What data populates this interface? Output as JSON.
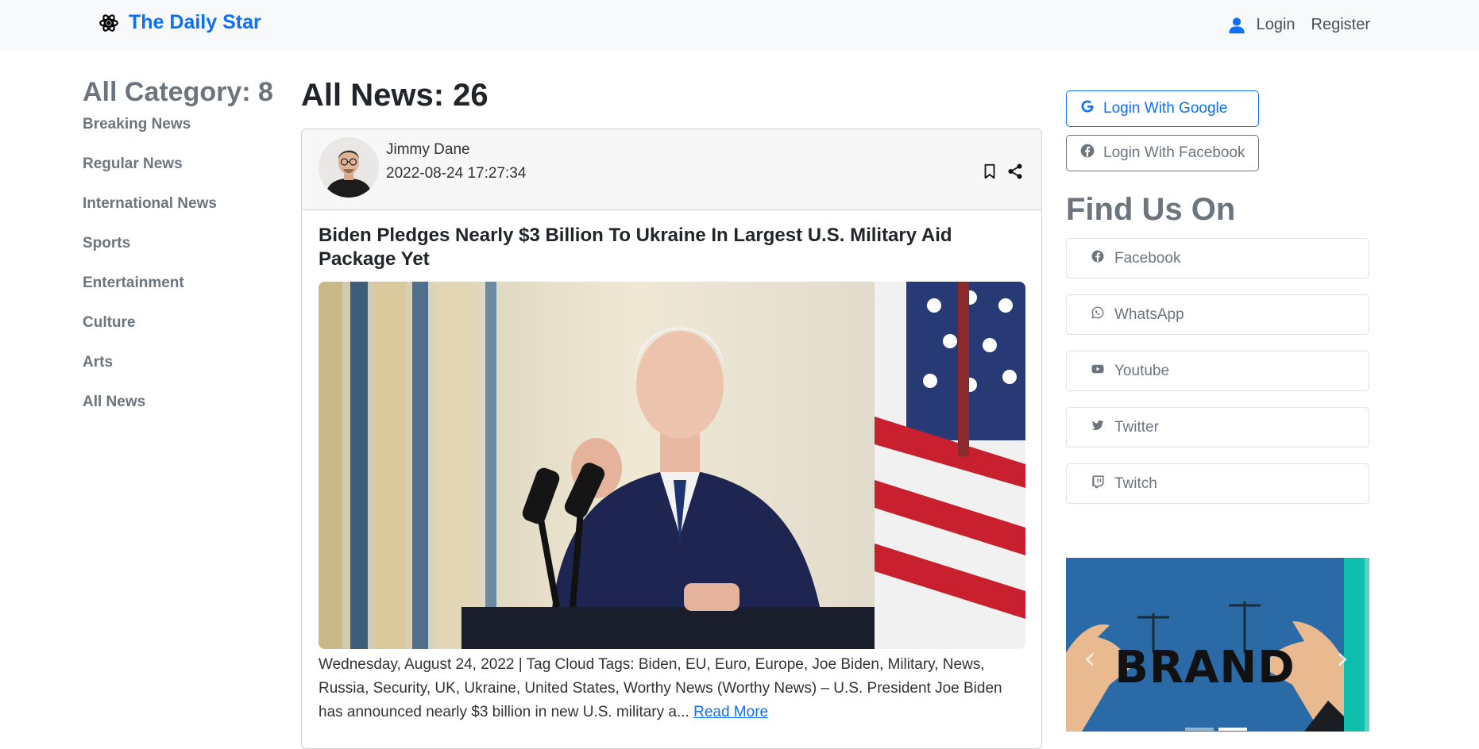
{
  "navbar": {
    "brand": "The Daily Star",
    "login_label": "Login",
    "register_label": "Register"
  },
  "categories": {
    "heading": "All Category: 8",
    "items": [
      "Breaking News",
      "Regular News",
      "International News",
      "Sports",
      "Entertainment",
      "Culture",
      "Arts",
      "All News"
    ]
  },
  "main": {
    "heading": "All News: 26",
    "article": {
      "author": "Jimmy Dane",
      "date": "2022-08-24 17:27:34",
      "title": "Biden Pledges Nearly $3 Billion To Ukraine In Largest U.S. Military Aid Package Yet",
      "excerpt": "Wednesday, August 24, 2022 | Tag Cloud Tags: Biden, EU, Euro, Europe, Joe Biden, Military, News, Russia, Security, UK, Ukraine, United States, Worthy News (Worthy News) – U.S. President Joe Biden has announced nearly $3 billion in new U.S. military a...",
      "read_more": "Read More"
    }
  },
  "sidebar_right": {
    "google_login": "Login With Google",
    "facebook_login": "Login With Facebook",
    "find_us_heading": "Find Us On",
    "social": [
      "Facebook",
      "WhatsApp",
      "Youtube",
      "Twitter",
      "Twitch"
    ],
    "carousel_text": "BRAND"
  },
  "colors": {
    "accent": "#0d6efd",
    "muted": "#6c757d",
    "navbar_bg": "#f8f9fa"
  }
}
